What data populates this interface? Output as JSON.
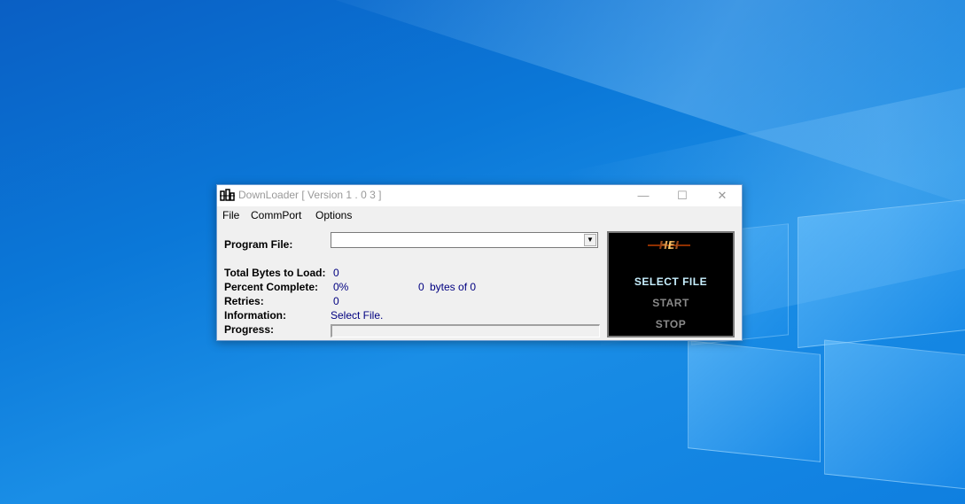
{
  "window": {
    "title": "DownLoader [ Version  1 . 0 3 ]",
    "min_glyph": "—",
    "max_glyph": "☐",
    "close_glyph": "✕"
  },
  "menu": [
    "File",
    "CommPort",
    "Options"
  ],
  "form": {
    "program_file_label": "Program File:",
    "program_file_value": "",
    "total_bytes_label": "Total Bytes to Load:",
    "total_bytes_value": "0",
    "percent_label": "Percent Complete:",
    "percent_value": "0%",
    "bytes_count": "0",
    "bytes_of_text": "bytes of 0",
    "retries_label": "Retries:",
    "retries_value": "0",
    "information_label": "Information:",
    "information_value": "Select File.",
    "progress_label": "Progress:",
    "progress_fraction": 0
  },
  "panel": {
    "logo_text": "HEI",
    "select_file": "SELECT FILE",
    "start": "START",
    "stop": "STOP"
  },
  "colors": {
    "value_text": "#000080",
    "active_button": "#c8f0ff",
    "disabled_button": "#8a8a8a",
    "logo": "#e8a040"
  }
}
